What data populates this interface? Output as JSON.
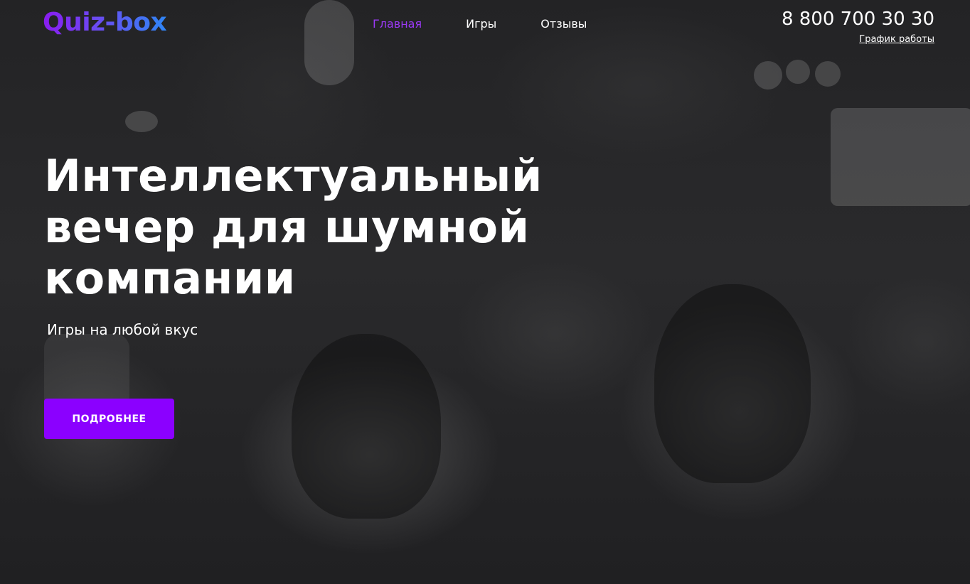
{
  "header": {
    "logo_text": "Quiz-box",
    "nav": [
      {
        "label": "Главная",
        "active": true
      },
      {
        "label": "Игры",
        "active": false
      },
      {
        "label": "Отзывы",
        "active": false
      }
    ],
    "phone": "8 800 700 30 30",
    "schedule_link": "График работы"
  },
  "hero": {
    "headline_lines": [
      "Интеллектуальный",
      "вечер для шумной",
      "компании"
    ],
    "subtitle": "Игры на любой вкус",
    "cta_label": "ПОДРОБНЕЕ"
  },
  "colors": {
    "accent": "#8b00ff",
    "nav_active": "#9b39f5",
    "logo_gradient_start": "#8a1cf0",
    "logo_gradient_end": "#2f86f5",
    "text": "#ffffff",
    "background": "#232325"
  }
}
